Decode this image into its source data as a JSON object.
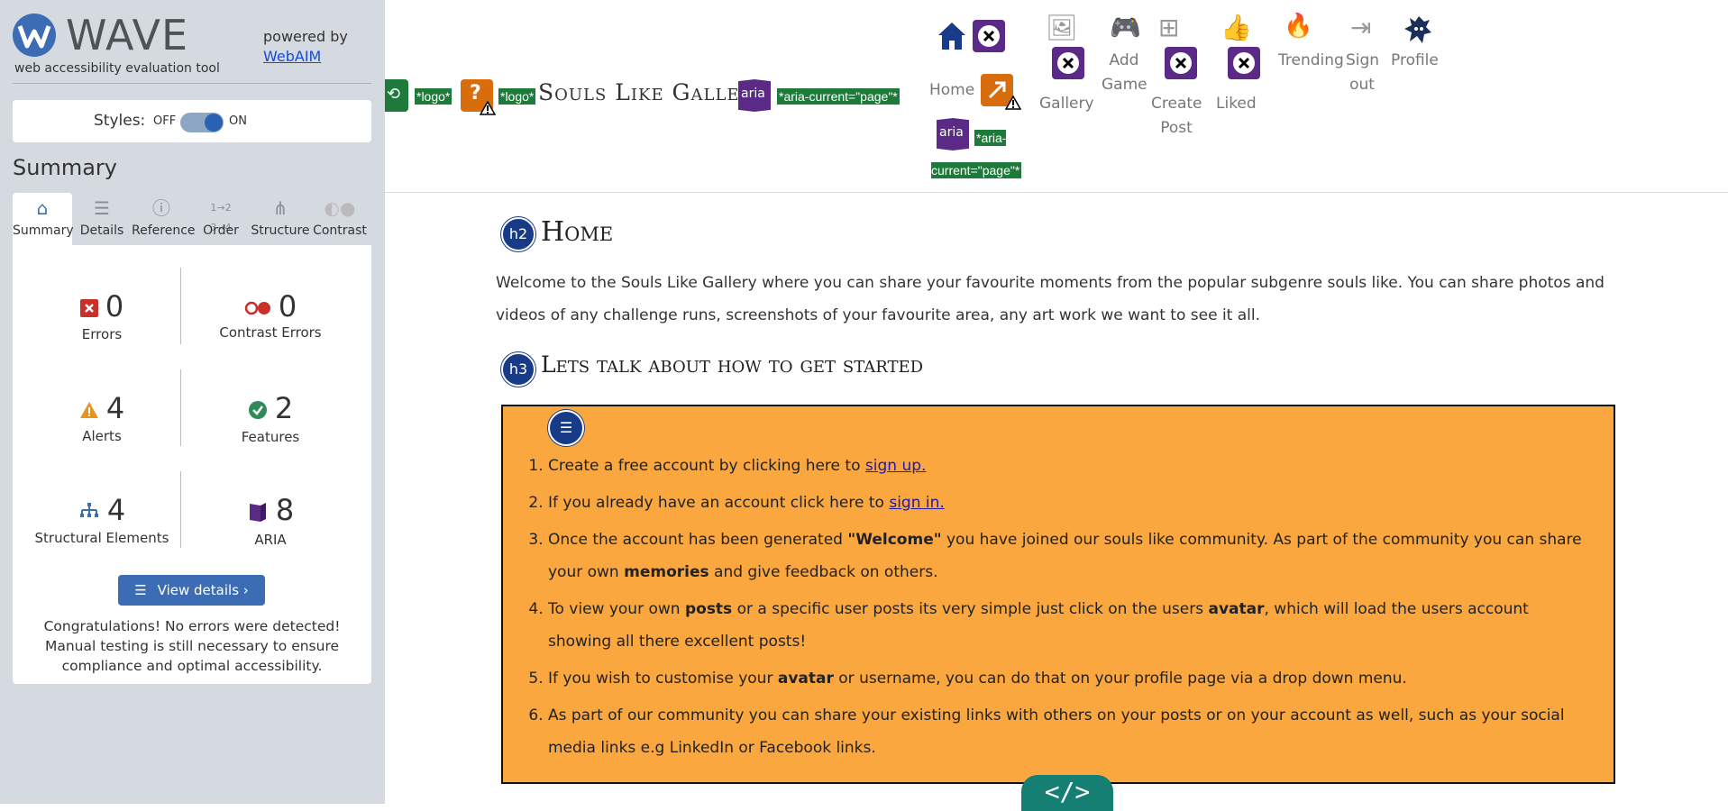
{
  "wave": {
    "title": "WAVE",
    "subtitle": "web accessibility evaluation tool",
    "powered_by": "powered by",
    "webaim_link": "WebAIM",
    "styles_label": "Styles:",
    "styles_off": "OFF",
    "styles_on": "ON",
    "summary_heading": "Summary",
    "tabs": [
      {
        "label": "Summary",
        "icon": "home-icon"
      },
      {
        "label": "Details",
        "icon": "list-icon"
      },
      {
        "label": "Reference",
        "icon": "info-icon"
      },
      {
        "label": "Order",
        "icon": "order-icon"
      },
      {
        "label": "Structure",
        "icon": "structure-icon"
      },
      {
        "label": "Contrast",
        "icon": "contrast-icon"
      }
    ],
    "stats": {
      "errors": {
        "count": "0",
        "label": "Errors"
      },
      "contrast_errors": {
        "count": "0",
        "label": "Contrast Errors"
      },
      "alerts": {
        "count": "4",
        "label": "Alerts"
      },
      "features": {
        "count": "2",
        "label": "Features"
      },
      "structural": {
        "count": "4",
        "label": "Structural Elements"
      },
      "aria": {
        "count": "8",
        "label": "ARIA"
      }
    },
    "view_details": "View details ›",
    "congrats": "Congratulations! No errors were detected! Manual testing is still necessary to ensure compliance and optimal accessibility.",
    "colors": {
      "accent": "#3b6cb4",
      "sidebar_bg": "#d5dae1"
    }
  },
  "nav": {
    "logo_tag_1": "*logo*",
    "logo_tag_2": "*logo*",
    "brand": "Souls Like Gallery",
    "aria_badge": "aria",
    "aria_current_1": "*aria-current=\"page\"*",
    "aria_current_2": "*aria-current=\"page\"*",
    "home": "Home",
    "gallery": "Gallery",
    "add_game": "Add Game",
    "create_post": "Create Post",
    "liked": "Liked",
    "trending": "Trending",
    "sign_out": "Sign out",
    "profile": "Profile"
  },
  "page": {
    "h2_badge": "h2",
    "h2": "Home",
    "intro": "Welcome to the Souls Like Gallery where you can share your favourite moments from the popular subgenre souls like. You can share photos and videos of any challenge runs, screenshots of your favourite area, any art work we want to see it all.",
    "h3_badge": "h3",
    "h3": "Lets talk about how to get started",
    "steps": {
      "s1_pre": "Create a free account by clicking here to ",
      "s1_link": "sign up.",
      "s2_pre": "If you already have an account click here to ",
      "s2_link": "sign in.",
      "s3_a": "Once the account has been generated ",
      "s3_b": "\"Welcome\"",
      "s3_c": " you have joined our souls like community. As part of the community you can share your own ",
      "s3_d": "memories",
      "s3_e": " and give feedback on others.",
      "s4_a": "To view your own ",
      "s4_b": "posts",
      "s4_c": " or a specific user posts its very simple just click on the users ",
      "s4_d": "avatar",
      "s4_e": ", which will load the users account showing all there excellent posts!",
      "s5_a": "If you wish to customise your ",
      "s5_b": "avatar",
      "s5_c": " or username, you can do that on your profile page via a drop down menu.",
      "s6": "As part of our community you can share your existing links with others on your posts or on your account as well, such as your social media links e.g LinkedIn or Facebook links."
    },
    "code_badge": "</>",
    "box_color": "#fba73f"
  }
}
